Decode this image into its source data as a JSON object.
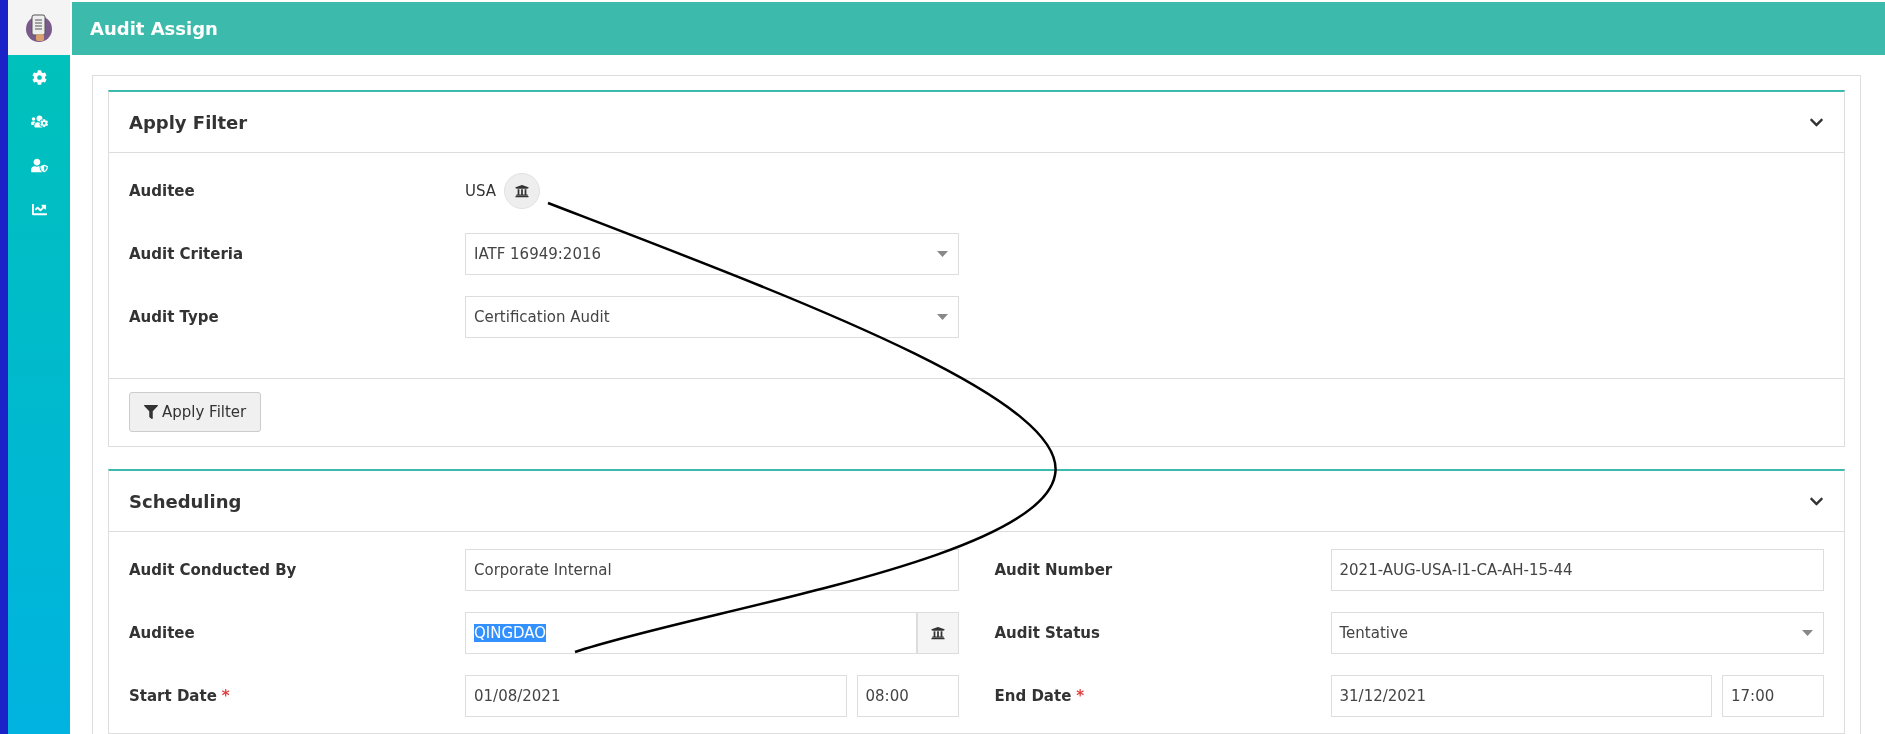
{
  "header": {
    "title": "Audit Assign"
  },
  "filter_panel": {
    "title": "Apply Filter",
    "expanded": true,
    "rows": [
      {
        "kind": "static",
        "label": "Auditee",
        "value": "USA"
      },
      {
        "kind": "select",
        "label": "Audit Criteria",
        "value": "IATF 16949:2016"
      },
      {
        "kind": "select",
        "label": "Audit Type",
        "value": "Certification Audit"
      }
    ],
    "button": "Apply Filter"
  },
  "scheduling_panel": {
    "title": "Scheduling",
    "expanded": true,
    "rows": [
      {
        "kind": "text",
        "label": "Audit Conducted By",
        "value": "Corporate Internal"
      },
      {
        "kind": "text",
        "label": "Audit Number",
        "value": "2021-AUG-USA-I1-CA-AH-15-44"
      },
      {
        "kind": "lookup",
        "label": "Auditee",
        "value": "QINGDAO",
        "highlighted": true
      },
      {
        "kind": "select",
        "label": "Audit Status",
        "value": "Tentative"
      },
      {
        "kind": "datetime",
        "label": "Start Date",
        "required_mark": "*",
        "value": "01/08/2021",
        "time": "08:00"
      },
      {
        "kind": "datetime",
        "label": "End Date",
        "required_mark": "*",
        "value": "31/12/2021",
        "time": "17:00"
      }
    ]
  }
}
